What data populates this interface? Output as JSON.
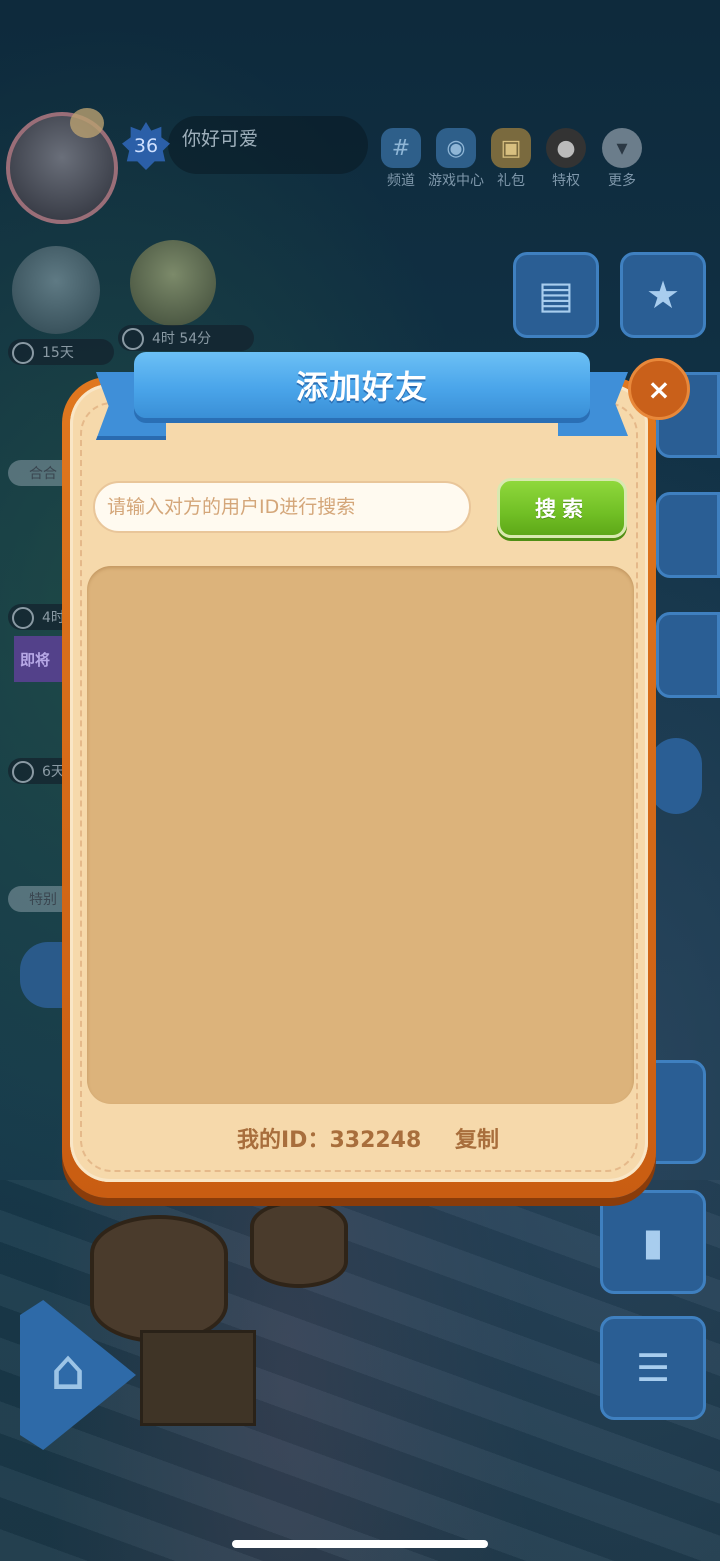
{
  "profile": {
    "level": "36",
    "name": "你好可爱"
  },
  "top_menu": [
    {
      "icon": "hash-icon",
      "glyph": "#",
      "label": "频道"
    },
    {
      "icon": "gamepad-icon",
      "glyph": "◉",
      "label": "游戏中心"
    },
    {
      "icon": "gift-icon",
      "glyph": "▣",
      "label": "礼包"
    },
    {
      "icon": "penguin-icon",
      "glyph": "●",
      "label": "特权"
    },
    {
      "icon": "chevron-down-icon",
      "glyph": "▾",
      "label": "更多"
    }
  ],
  "events": {
    "timer1": "15天",
    "timer2": "4时 54分",
    "timer3": "4时",
    "timer4": "6天",
    "tag1": "合合",
    "tag2": "特别",
    "promo": "即将"
  },
  "dialog": {
    "title": "添加好友",
    "close_glyph": "×",
    "search_placeholder": "请输入对方的用户ID进行搜索",
    "search_value": "",
    "search_button": "搜索",
    "my_id_text": "我的ID：332248",
    "copy_label": "复制"
  },
  "colors": {
    "ribbon": "#4aa5ea",
    "panel_border": "#e0771e",
    "panel_fill": "#f6d9ab",
    "search_button": "#71bf25",
    "result_area": "#dcb37b",
    "id_text": "#a86e3c"
  }
}
